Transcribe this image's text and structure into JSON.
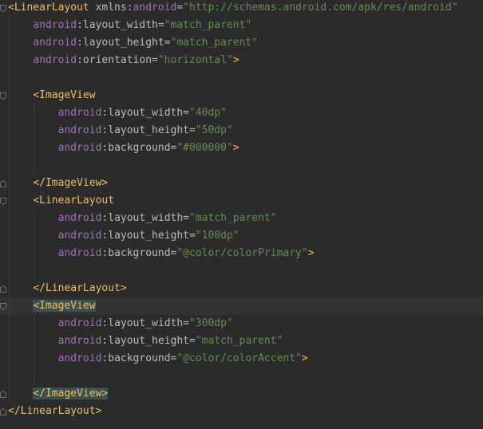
{
  "lines": [
    {
      "indent": "",
      "parts": [
        [
          "bracket",
          "<"
        ],
        [
          "tag",
          "LinearLayout"
        ],
        [
          "attr",
          " xmlns:"
        ],
        [
          "ns",
          "android"
        ],
        [
          "eq",
          "="
        ],
        [
          "val",
          "\"http://schemas.android.com/apk/res/android\""
        ]
      ]
    },
    {
      "indent": "    ",
      "parts": [
        [
          "ns",
          "android"
        ],
        [
          "attr",
          ":layout_width"
        ],
        [
          "eq",
          "="
        ],
        [
          "val",
          "\"match_parent\""
        ]
      ]
    },
    {
      "indent": "    ",
      "parts": [
        [
          "ns",
          "android"
        ],
        [
          "attr",
          ":layout_height"
        ],
        [
          "eq",
          "="
        ],
        [
          "val",
          "\"match_parent\""
        ]
      ]
    },
    {
      "indent": "    ",
      "parts": [
        [
          "ns",
          "android"
        ],
        [
          "attr",
          ":orientation"
        ],
        [
          "eq",
          "="
        ],
        [
          "val",
          "\"horizontal\""
        ],
        [
          "bracket",
          ">"
        ]
      ]
    },
    {
      "indent": "",
      "parts": []
    },
    {
      "indent": "    ",
      "parts": [
        [
          "bracket",
          "<"
        ],
        [
          "tag",
          "ImageView"
        ]
      ]
    },
    {
      "indent": "        ",
      "parts": [
        [
          "ns",
          "android"
        ],
        [
          "attr",
          ":layout_width"
        ],
        [
          "eq",
          "="
        ],
        [
          "val",
          "\"40dp\""
        ]
      ]
    },
    {
      "indent": "        ",
      "parts": [
        [
          "ns",
          "android"
        ],
        [
          "attr",
          ":layout_height"
        ],
        [
          "eq",
          "="
        ],
        [
          "val",
          "\"50dp\""
        ]
      ]
    },
    {
      "indent": "        ",
      "parts": [
        [
          "ns",
          "android"
        ],
        [
          "attr",
          ":background"
        ],
        [
          "eq",
          "="
        ],
        [
          "val",
          "\"#000000\""
        ],
        [
          "bracket",
          ">"
        ]
      ]
    },
    {
      "indent": "",
      "parts": []
    },
    {
      "indent": "    ",
      "parts": [
        [
          "bracket",
          "</"
        ],
        [
          "tag",
          "ImageView"
        ],
        [
          "bracket",
          ">"
        ]
      ]
    },
    {
      "indent": "    ",
      "parts": [
        [
          "bracket",
          "<"
        ],
        [
          "tag",
          "LinearLayout"
        ]
      ]
    },
    {
      "indent": "        ",
      "parts": [
        [
          "ns",
          "android"
        ],
        [
          "attr",
          ":layout_width"
        ],
        [
          "eq",
          "="
        ],
        [
          "val",
          "\"match_parent\""
        ]
      ]
    },
    {
      "indent": "        ",
      "parts": [
        [
          "ns",
          "android"
        ],
        [
          "attr",
          ":layout_height"
        ],
        [
          "eq",
          "="
        ],
        [
          "val",
          "\"100dp\""
        ]
      ]
    },
    {
      "indent": "        ",
      "parts": [
        [
          "ns",
          "android"
        ],
        [
          "attr",
          ":background"
        ],
        [
          "eq",
          "="
        ],
        [
          "val",
          "\"@color/colorPrimary\""
        ],
        [
          "bracket",
          ">"
        ]
      ]
    },
    {
      "indent": "",
      "parts": []
    },
    {
      "indent": "    ",
      "parts": [
        [
          "bracket",
          "</"
        ],
        [
          "tag",
          "LinearLayout"
        ],
        [
          "bracket",
          ">"
        ]
      ]
    },
    {
      "indent": "    ",
      "current": true,
      "parts": [
        [
          "bracket",
          "<"
        ],
        [
          "tag",
          "ImageView"
        ]
      ]
    },
    {
      "indent": "        ",
      "parts": [
        [
          "ns",
          "android"
        ],
        [
          "attr",
          ":layout_width"
        ],
        [
          "eq",
          "="
        ],
        [
          "val",
          "\"300dp\""
        ]
      ]
    },
    {
      "indent": "        ",
      "parts": [
        [
          "ns",
          "android"
        ],
        [
          "attr",
          ":layout_height"
        ],
        [
          "eq",
          "="
        ],
        [
          "val",
          "\"match_parent\""
        ]
      ]
    },
    {
      "indent": "        ",
      "parts": [
        [
          "ns",
          "android"
        ],
        [
          "attr",
          ":background"
        ],
        [
          "eq",
          "="
        ],
        [
          "val",
          "\"@color/colorAccent\""
        ],
        [
          "bracket",
          ">"
        ]
      ]
    },
    {
      "indent": "",
      "parts": []
    },
    {
      "indent": "    ",
      "parts": [
        [
          "bracket",
          "</"
        ],
        [
          "tag",
          "ImageView"
        ],
        [
          "bracket",
          ">"
        ]
      ]
    },
    {
      "indent": "",
      "parts": [
        [
          "bracket",
          "</"
        ],
        [
          "tag",
          "LinearLayout"
        ],
        [
          "bracket",
          ">"
        ]
      ]
    }
  ],
  "highlight": {
    "open_line": 17,
    "close_line": 22
  },
  "colors": {
    "background": "#2b2b2b",
    "current_line": "#323232",
    "tag": "#e8bf6a",
    "namespace": "#9876aa",
    "attribute": "#bababa",
    "value": "#6a8759",
    "brace_match": "#3b514d"
  }
}
